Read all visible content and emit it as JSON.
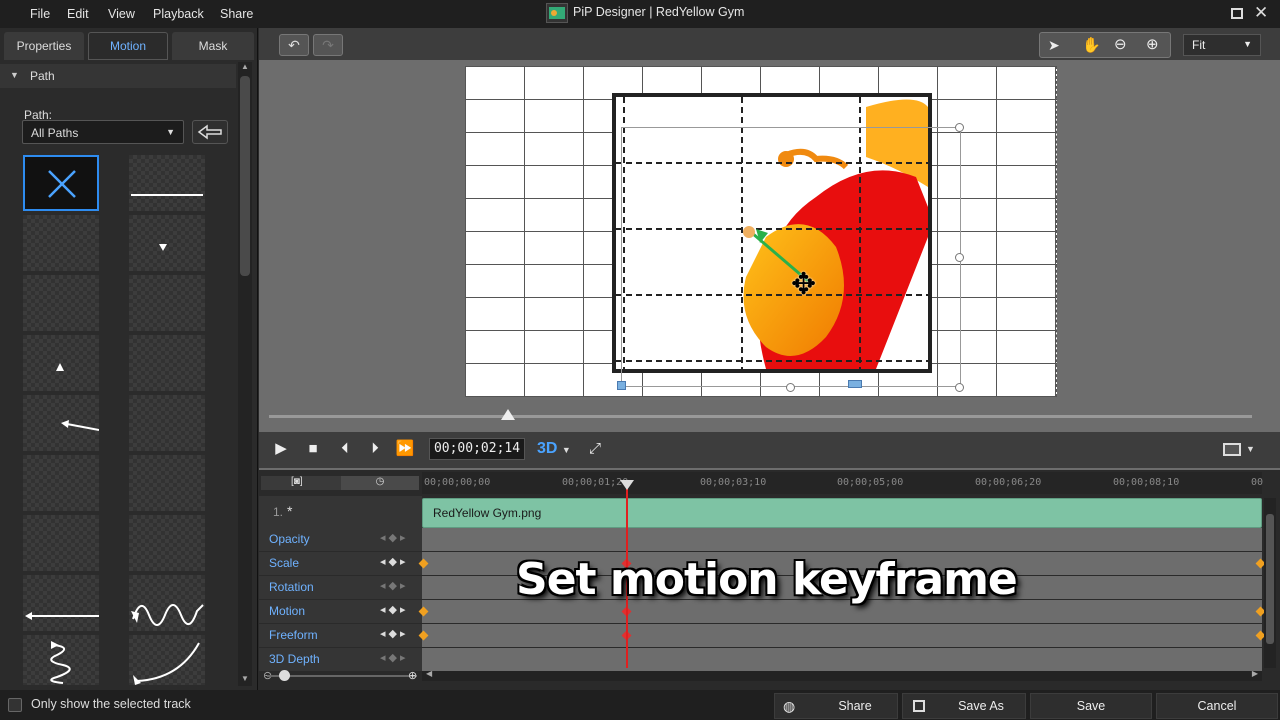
{
  "menu": {
    "file": "File",
    "edit": "Edit",
    "view": "View",
    "playback": "Playback",
    "share": "Share"
  },
  "app_title": "PiP Designer  |  RedYellow Gym",
  "tabs": {
    "properties": "Properties",
    "motion": "Motion",
    "mask": "Mask"
  },
  "path_section": {
    "header": "Path",
    "field_label": "Path:",
    "selected": "All Paths"
  },
  "preview": {
    "zoom": "Fit"
  },
  "playback": {
    "timecode": "00;00;02;14",
    "mode_3d": "3D"
  },
  "timeline": {
    "ticks": [
      "00;00;00;00",
      "00;00;01;20",
      "00;00;03;10",
      "00;00;05;00",
      "00;00;06;20",
      "00;00;08;10",
      "00"
    ],
    "track_number": "1.",
    "clip_name": "RedYellow Gym.png",
    "attributes": [
      "Opacity",
      "Scale",
      "Rotation",
      "Motion",
      "Freeform",
      "3D Depth"
    ]
  },
  "overlay_caption": "Set motion keyframe",
  "footer": {
    "only_selected": "Only show the selected track",
    "share": "Share",
    "save_as": "Save As",
    "save": "Save",
    "cancel": "Cancel"
  },
  "colors": {
    "accent": "#2e8cf0",
    "clip": "#7ec3a4",
    "playhead": "#e02020"
  }
}
